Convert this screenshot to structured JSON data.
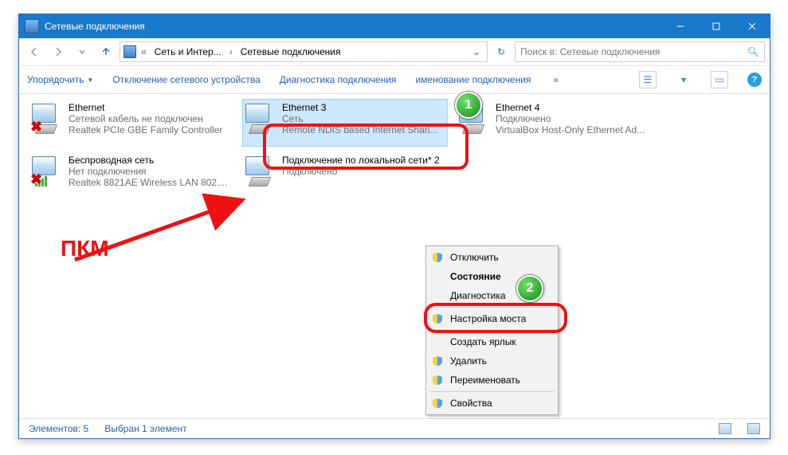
{
  "title": "Сетевые подключения",
  "breadcrumbs": [
    "Сеть и Интер...",
    "Сетевые подключения"
  ],
  "search_placeholder": "Поиск в: Сетевые подключения",
  "toolbar": {
    "organize": "Упорядочить",
    "disable": "Отключение сетевого устройства",
    "diagnose": "Диагностика подключения",
    "rename_trunc": "именование подключения",
    "more": "»"
  },
  "connections": [
    {
      "name": "Ethernet",
      "line2": "Сетевой кабель не подключен",
      "line3": "Realtek PCIe GBE Family Controller",
      "x": true,
      "wifi": false
    },
    {
      "name": "Ethernet 3",
      "line2": "Сеть",
      "line3": "Remote NDIS based Internet Shari...",
      "x": false,
      "wifi": false,
      "selected": true
    },
    {
      "name": "Ethernet 4",
      "line2": "Подключено",
      "line3": "VirtualBox Host-Only Ethernet Ad...",
      "x": false,
      "wifi": false
    },
    {
      "name": "Беспроводная сеть",
      "line2": "Нет подключения",
      "line3": "Realtek 8821AE Wireless LAN 802....",
      "x": true,
      "wifi": true
    },
    {
      "name": "Подключение по локальной сети* 2",
      "line2": "Подключено",
      "line3": "",
      "x": false,
      "wifi": false
    }
  ],
  "context_menu": {
    "disable": "Отключить",
    "status": "Состояние",
    "diagnose": "Диагностика",
    "bridge": "Настройка моста",
    "shortcut": "Создать ярлык",
    "delete": "Удалить",
    "rename": "Переименовать",
    "properties": "Свойства"
  },
  "annotation": "ПКМ",
  "statusbar": {
    "count": "Элементов: 5",
    "sel": "Выбран 1 элемент"
  }
}
